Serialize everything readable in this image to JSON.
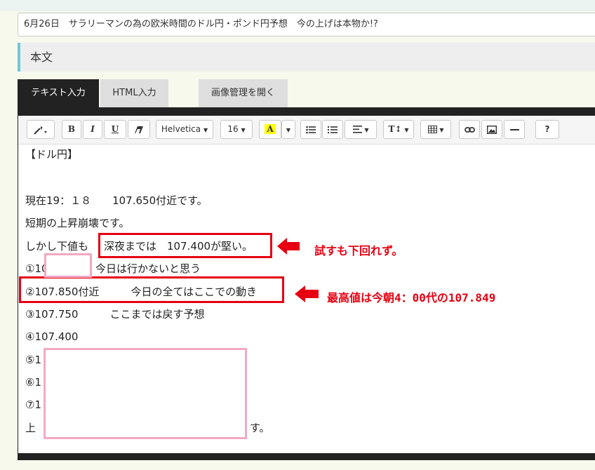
{
  "title_input": {
    "value": "6月26日　サラリーマンの為の欧米時間のドル円・ポンド円予想　今の上げは本物か!?"
  },
  "section": {
    "label": "本文"
  },
  "tabs": [
    {
      "label": "テキスト入力",
      "active": true
    },
    {
      "label": "HTML入力",
      "active": false
    },
    {
      "label": "画像管理を開く",
      "active": false
    }
  ],
  "toolbar": {
    "font_family": "Helvetica",
    "font_size": "16",
    "bold": "B",
    "italic": "I",
    "underline": "U",
    "color_letter": "A",
    "help": "?",
    "icons": [
      "magic-wand-icon",
      "eraser-icon",
      "chevron-down-icon",
      "bullet-list-icon",
      "numbered-list-icon",
      "align-icon",
      "text-height-icon",
      "table-icon",
      "link-icon",
      "image-icon",
      "horizontal-rule-icon"
    ]
  },
  "content": {
    "heading": "【ドル円】",
    "line_now": "現在19：１８　　107.650付近です。",
    "line_short": "短期の上昇崩壊です。",
    "line_but": "しかし下値も",
    "line_but_box": "深夜までは　107.400が堅い。",
    "line_1_prefix": "①10",
    "line_1_suffix": "今日は行かないと思う",
    "line_2": "②107.850付近　　　今日の全てはここでの動き",
    "line_3": "③107.750　　　ここまでは戻す予想",
    "line_4": "④107.400",
    "line_5": "⑤1",
    "line_6": "⑥1",
    "line_7": "⑦1",
    "line_bottom_prefix": "上",
    "line_bottom_suffix": "す。"
  },
  "annotations": {
    "note1": "試すも下回れず。",
    "note2": "最高値は今朝4：00代の107.849",
    "color": "#e60012"
  }
}
